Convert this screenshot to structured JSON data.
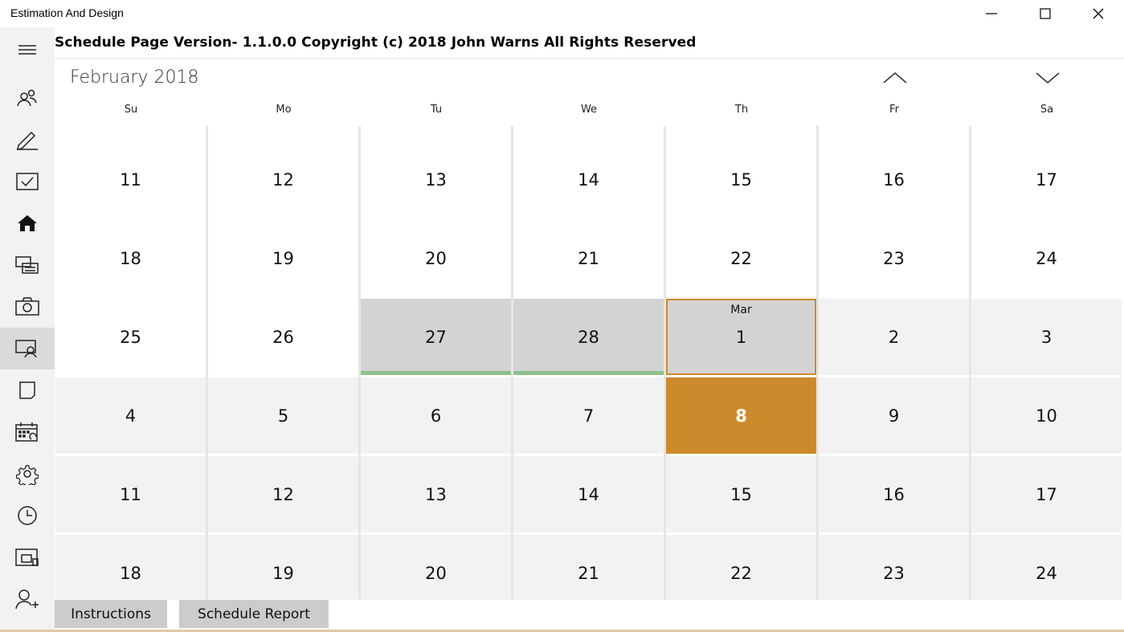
{
  "window": {
    "title": "Estimation And Design",
    "controls": [
      "minimize-icon",
      "maximize-icon",
      "close-icon"
    ]
  },
  "sidebar": {
    "items": [
      {
        "icon": "hamburger-menu-icon"
      },
      {
        "icon": "people-icon"
      },
      {
        "icon": "pencil-icon"
      },
      {
        "icon": "checkbox-icon"
      },
      {
        "icon": "home-icon"
      },
      {
        "icon": "printer-icon"
      },
      {
        "icon": "camera-icon"
      },
      {
        "icon": "screen-user-icon",
        "selected": true
      },
      {
        "icon": "page-icon"
      },
      {
        "icon": "calendar-sync-icon"
      },
      {
        "icon": "gear-icon"
      },
      {
        "icon": "clock-icon"
      },
      {
        "icon": "windows-icon"
      },
      {
        "icon": "add-user-icon"
      }
    ]
  },
  "header": {
    "title": "Schedule Page Version- 1.1.0.0 Copyright (c) 2018 John Warns All Rights Reserved"
  },
  "calendar": {
    "month_label": "February 2018",
    "prev_icon": "chevron-up-icon",
    "next_icon": "chevron-down-icon",
    "weekdays": [
      "Su",
      "Mo",
      "Tu",
      "We",
      "Th",
      "Fr",
      "Sa"
    ],
    "weeks": [
      [
        {
          "d": "11",
          "s": "cur"
        },
        {
          "d": "12",
          "s": "cur"
        },
        {
          "d": "13",
          "s": "cur"
        },
        {
          "d": "14",
          "s": "cur"
        },
        {
          "d": "15",
          "s": "cur"
        },
        {
          "d": "16",
          "s": "cur"
        },
        {
          "d": "17",
          "s": "cur"
        }
      ],
      [
        {
          "d": "18",
          "s": "cur"
        },
        {
          "d": "19",
          "s": "cur"
        },
        {
          "d": "20",
          "s": "cur"
        },
        {
          "d": "21",
          "s": "cur"
        },
        {
          "d": "22",
          "s": "cur"
        },
        {
          "d": "23",
          "s": "cur"
        },
        {
          "d": "24",
          "s": "cur"
        }
      ],
      [
        {
          "d": "25",
          "s": "cur"
        },
        {
          "d": "26",
          "s": "cur"
        },
        {
          "d": "27",
          "s": "blackout",
          "event": true
        },
        {
          "d": "28",
          "s": "blackout",
          "event": true
        },
        {
          "d": "1",
          "s": "selected-day",
          "tag": "Mar"
        },
        {
          "d": "2",
          "s": "oth"
        },
        {
          "d": "3",
          "s": "oth"
        }
      ],
      [
        {
          "d": "4",
          "s": "oth"
        },
        {
          "d": "5",
          "s": "oth"
        },
        {
          "d": "6",
          "s": "oth"
        },
        {
          "d": "7",
          "s": "oth"
        },
        {
          "d": "8",
          "s": "today"
        },
        {
          "d": "9",
          "s": "oth"
        },
        {
          "d": "10",
          "s": "oth"
        }
      ],
      [
        {
          "d": "11",
          "s": "oth"
        },
        {
          "d": "12",
          "s": "oth"
        },
        {
          "d": "13",
          "s": "oth"
        },
        {
          "d": "14",
          "s": "oth"
        },
        {
          "d": "15",
          "s": "oth"
        },
        {
          "d": "16",
          "s": "oth"
        },
        {
          "d": "17",
          "s": "oth"
        }
      ],
      [
        {
          "d": "18",
          "s": "oth"
        },
        {
          "d": "19",
          "s": "oth"
        },
        {
          "d": "20",
          "s": "oth"
        },
        {
          "d": "21",
          "s": "oth"
        },
        {
          "d": "22",
          "s": "oth"
        },
        {
          "d": "23",
          "s": "oth"
        },
        {
          "d": "24",
          "s": "oth"
        }
      ]
    ],
    "colors": {
      "today": "#cd8a2d",
      "selected_border": "#cd8a2d",
      "blackout": "#d3d3d3",
      "event_bar": "#8ec08e",
      "other_month": "#f2f2f2"
    }
  },
  "footer": {
    "instructions_label": "Instructions",
    "report_label": "Schedule Report"
  }
}
